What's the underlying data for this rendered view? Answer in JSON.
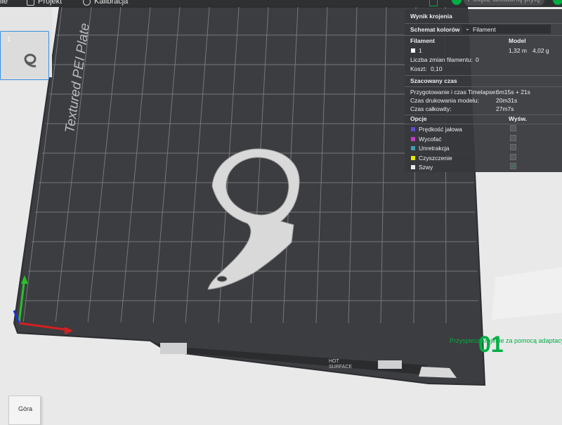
{
  "topbar": {
    "menu_file": "ile",
    "menu_project": "Projekt",
    "menu_calibration": "Kalibracja",
    "merge_plate_button": "Połącz aktualną płytę"
  },
  "plate": {
    "plate_label": "Textured PEI Plate",
    "hot_surface": [
      "HOT",
      "SURFACE"
    ]
  },
  "plate_list": {
    "plate_number": "1"
  },
  "results": {
    "title": "Wynik krojenia",
    "scheme_label": "Schemat kolorów",
    "scheme_value": "Filament",
    "col_filament": "Filament",
    "col_model": "Model",
    "filament_index": "1",
    "filament_length": "1,32 m",
    "filament_weight": "4,02 g",
    "changes_label": "Liczba zmian filamentu:",
    "changes_value": "0",
    "cost_label": "Koszt:",
    "cost_value": "0,10",
    "time_header": "Szacowany czas",
    "prep_label": "Przygotowanie i czas Timelapse:",
    "prep_value": "6m15s + 21s",
    "model_time_label": "Czas drukowania modelu:",
    "model_time_value": "20m31s",
    "total_label": "Czas całkowity:",
    "total_value": "27m7s",
    "options_header": "Opcje",
    "display_header": "Wyśw.",
    "options": [
      {
        "label": "Prędkość jałowa",
        "color": "#5b4dcf",
        "checked": false
      },
      {
        "label": "Wycofać",
        "color": "#c23dc2",
        "checked": false
      },
      {
        "label": "Unretrakcja",
        "color": "#3f9fb0",
        "checked": false
      },
      {
        "label": "Czyszczenie",
        "color": "#e6e600",
        "checked": false
      },
      {
        "label": "Szwy",
        "color": "#e8e8e8",
        "checked": true
      }
    ],
    "check_mark": "✓"
  },
  "overlay": {
    "adaptive_tip": "Przyspiesz krojenie za pomocą adaptacyjnej w",
    "big_number": "01"
  },
  "view_cube": {
    "label": "Góra"
  },
  "colors": {
    "accent": "#00ae42",
    "panel_bg": "#36383c",
    "plate": "#3c3d40"
  }
}
